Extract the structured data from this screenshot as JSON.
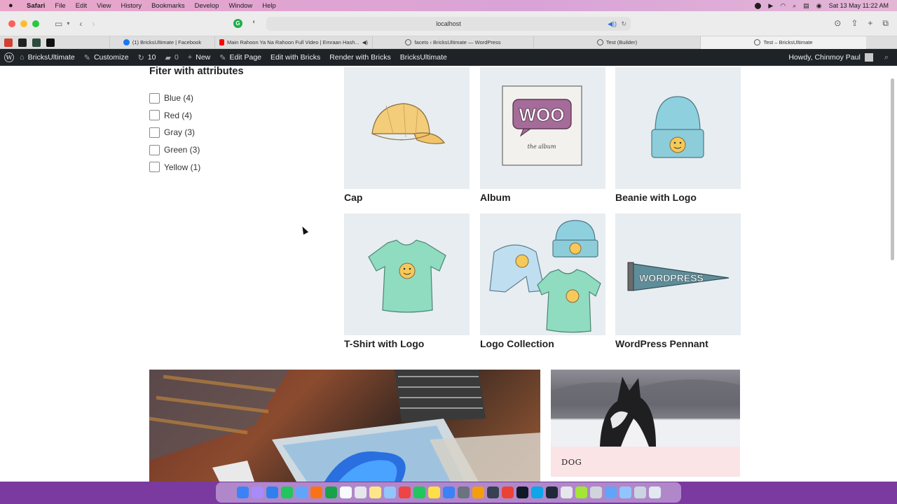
{
  "menubar": {
    "app": "Safari",
    "items": [
      "File",
      "Edit",
      "View",
      "History",
      "Bookmarks",
      "Develop",
      "Window",
      "Help"
    ],
    "datetime": "Sat 13 May  11:22 AM"
  },
  "browser": {
    "url": "localhost",
    "tabs": [
      {
        "title": "(1) BricksUltimate | Facebook",
        "color": "#1877f2"
      },
      {
        "title": "Main Rahoon Ya Na Rahoon Full Video | Emraan Hash...",
        "color": "#ff0000"
      },
      {
        "title": "facets ‹ BricksUltimate — WordPress",
        "color": "#555555"
      },
      {
        "title": "Test (Builder)",
        "color": "#555555"
      },
      {
        "title": "Test – BricksUltimate",
        "color": "#555555"
      }
    ]
  },
  "adminbar": {
    "site": "BricksUltimate",
    "customize": "Customize",
    "updates": "10",
    "comments": "0",
    "new": "New",
    "edit_page": "Edit Page",
    "edit_with_bricks": "Edit with Bricks",
    "render_with_bricks": "Render with Bricks",
    "bricks_ultimate": "BricksUltimate",
    "howdy": "Howdy, Chinmoy Paul"
  },
  "filter": {
    "title": "Fiter with attributes",
    "options": [
      "Blue (4)",
      "Red (4)",
      "Gray (3)",
      "Green (3)",
      "Yellow (1)"
    ]
  },
  "products": [
    {
      "name": "Cap",
      "icon": "cap-icon"
    },
    {
      "name": "Album",
      "icon": "album-icon"
    },
    {
      "name": "Beanie with Logo",
      "icon": "beanie-icon"
    },
    {
      "name": "T-Shirt with Logo",
      "icon": "tshirt-icon"
    },
    {
      "name": "Logo Collection",
      "icon": "logo-collection-icon"
    },
    {
      "name": "WordPress Pennant",
      "icon": "pennant-icon"
    }
  ],
  "album_art": {
    "word": "WOO",
    "sub": "the album"
  },
  "pennant_text": "WORDPRESS",
  "dog_card": {
    "label": "DOG"
  }
}
